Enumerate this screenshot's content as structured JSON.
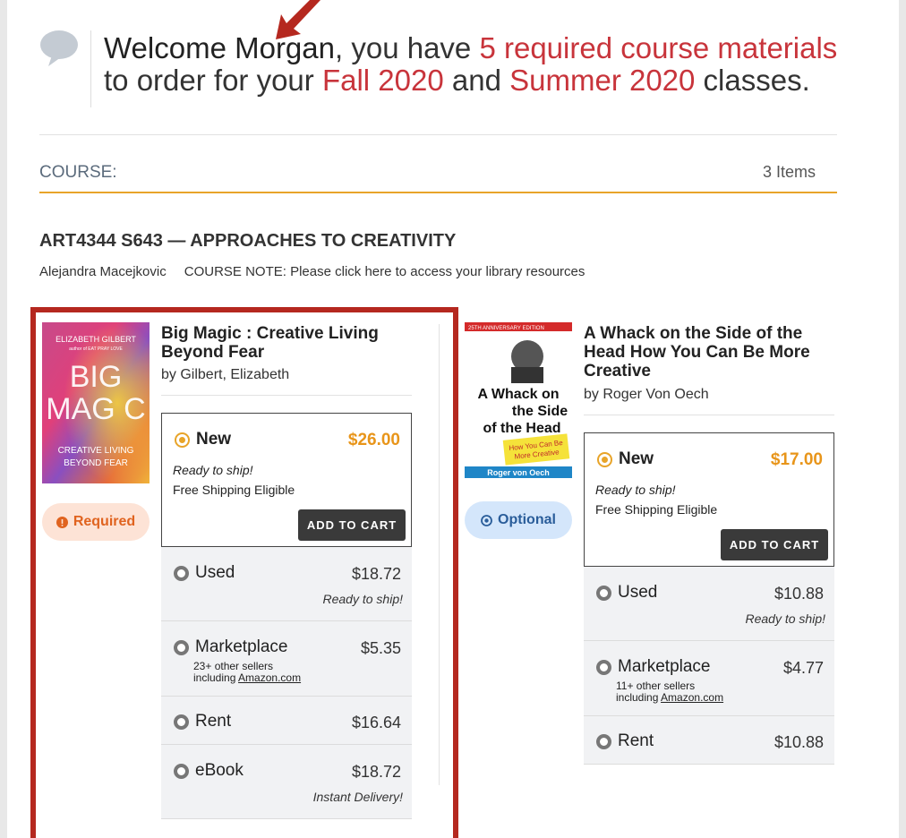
{
  "welcome": {
    "greeting": "Welcome Morgan",
    "part1": ", you have ",
    "count_phrase": "5 required course materials",
    "part2": "to order for your ",
    "term1": "Fall 2020",
    "part3": " and ",
    "term2": "Summer 2020",
    "part4": " classes."
  },
  "course_header": {
    "label": "COURSE:",
    "items": "3 Items"
  },
  "course": {
    "title": "ART4344 S643 — APPROACHES TO CREATIVITY",
    "instructor": "Alejandra Macejkovic",
    "note": "COURSE NOTE: Please click here to access your library resources"
  },
  "colors": {
    "accent": "#e8a429",
    "highlight_red": "#c8343b",
    "box_red": "#b5281f"
  },
  "books": [
    {
      "title": "Big Magic : Creative Living Beyond Fear",
      "author": "by Gilbert, Elizabeth",
      "badge": "Required",
      "cover": {
        "top": "ELIZABETH GILBERT",
        "sub": "author of EAT PRAY LOVE",
        "big1": "BIG",
        "big2": "MAG C",
        "bottom1": "CREATIVE LIVING",
        "bottom2": "BEYOND FEAR"
      },
      "new": {
        "label": "New",
        "price": "$26.00",
        "ship1": "Ready to ship!",
        "ship2": "Free Shipping Eligible",
        "button": "ADD TO CART"
      },
      "used": {
        "label": "Used",
        "price": "$18.72",
        "sub": "Ready to ship!"
      },
      "marketplace": {
        "label": "Marketplace",
        "price": "$5.35",
        "sellers1": "23+ other sellers",
        "sellers2_pre": "including ",
        "sellers2_link": "Amazon.com"
      },
      "rent": {
        "label": "Rent",
        "price": "$16.64"
      },
      "ebook": {
        "label": "eBook",
        "price": "$18.72",
        "sub": "Instant Delivery!"
      }
    },
    {
      "title": "A Whack on the Side of the Head How You Can Be More Creative",
      "author": "by Roger Von Oech",
      "badge": "Optional",
      "cover": {
        "top": "25TH ANNIVERSARY EDITION",
        "title1": "A Whack on",
        "title2": "the Side",
        "title3": "of the Head",
        "sticker1": "How You Can Be",
        "sticker2": "More Creative",
        "author": "Roger von Oech"
      },
      "new": {
        "label": "New",
        "price": "$17.00",
        "ship1": "Ready to ship!",
        "ship2": "Free Shipping Eligible",
        "button": "ADD TO CART"
      },
      "used": {
        "label": "Used",
        "price": "$10.88",
        "sub": "Ready to ship!"
      },
      "marketplace": {
        "label": "Marketplace",
        "price": "$4.77",
        "sellers1": "11+ other sellers",
        "sellers2_pre": "including ",
        "sellers2_link": "Amazon.com"
      },
      "rent": {
        "label": "Rent",
        "price": "$10.88"
      }
    }
  ]
}
